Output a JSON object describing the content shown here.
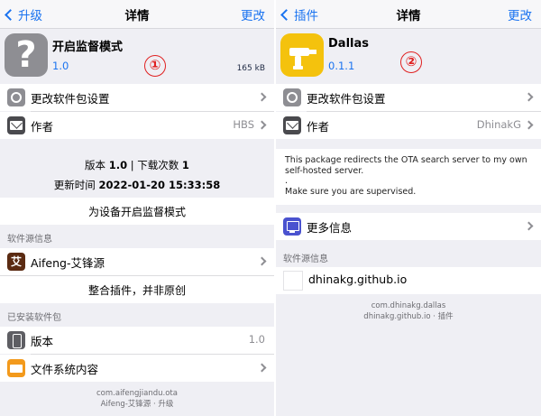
{
  "left": {
    "nav": {
      "back_label": "升级",
      "title": "详情",
      "action_label": "更改"
    },
    "package": {
      "name": "开启监督模式",
      "version": "1.0",
      "size": "165 kB",
      "icon_glyph": "?",
      "marker": "①"
    },
    "rows": {
      "change_settings": "更改软件包设置",
      "author_label": "作者",
      "author_value": "HBS"
    },
    "info": {
      "version_prefix": "版本 ",
      "version_value": "1.0",
      "downloads_prefix": " | 下载次数 ",
      "downloads_value": "1",
      "updated_prefix": "更新时间 ",
      "updated_value": "2022-01-20 15:33:58",
      "description": "为设备开启监督模式"
    },
    "source_section": {
      "label": "软件源信息",
      "source_name": "Aifeng-艾锋源",
      "source_note": "整合插件，并非原创",
      "icon_glyph": "艾"
    },
    "installed_section": {
      "label": "已安装软件包",
      "version_label": "版本",
      "version_value": "1.0",
      "filesystem_label": "文件系统内容"
    },
    "footer": {
      "line1": "com.aifengjiandu.ota",
      "line2": "Aifeng-艾锋源 · 升级"
    }
  },
  "right": {
    "nav": {
      "back_label": "插件",
      "title": "详情",
      "action_label": "更改"
    },
    "package": {
      "name": "Dallas",
      "version": "0.1.1",
      "marker": "②"
    },
    "rows": {
      "change_settings": "更改软件包设置",
      "author_label": "作者",
      "author_value": "DhinakG"
    },
    "description_lines": [
      "This package redirects the OTA search server to my own",
      "self-hosted server.",
      ".",
      "Make sure you are supervised."
    ],
    "more_info_label": "更多信息",
    "source_section": {
      "label": "软件源信息",
      "source_name": "dhinakg.github.io"
    },
    "footer": {
      "line1": "com.dhinakg.dallas",
      "line2": "dhinakg.github.io · 插件"
    }
  },
  "colors": {
    "accent": "#1a73f0",
    "marker": "#e02020",
    "background": "#efeff4",
    "dallas_icon": "#f4c20d"
  }
}
